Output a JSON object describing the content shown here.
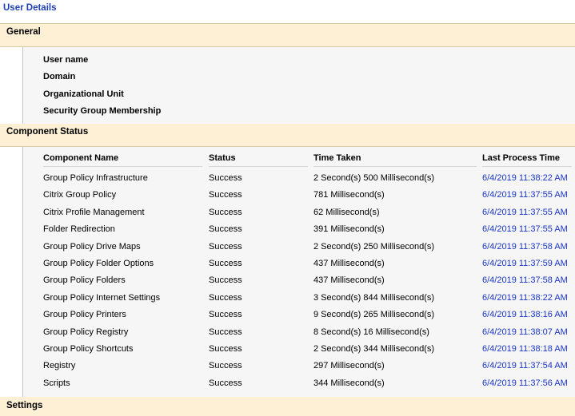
{
  "page": {
    "title": "User Details"
  },
  "general": {
    "title": "General",
    "fields": [
      {
        "label": "User name"
      },
      {
        "label": "Domain"
      },
      {
        "label": "Organizational Unit"
      },
      {
        "label": "Security Group Membership"
      }
    ]
  },
  "component_status": {
    "title": "Component Status",
    "columns": [
      "Component Name",
      "Status",
      "Time Taken",
      "Last Process Time"
    ],
    "rows": [
      {
        "name": "Group Policy Infrastructure",
        "status": "Success",
        "time_taken": "2 Second(s) 500 Millisecond(s)",
        "last_process_time": "6/4/2019 11:38:22 AM"
      },
      {
        "name": "Citrix Group Policy",
        "status": "Success",
        "time_taken": "781 Millisecond(s)",
        "last_process_time": "6/4/2019 11:37:55 AM"
      },
      {
        "name": "Citrix Profile Management",
        "status": "Success",
        "time_taken": "62 Millisecond(s)",
        "last_process_time": "6/4/2019 11:37:55 AM"
      },
      {
        "name": "Folder Redirection",
        "status": "Success",
        "time_taken": "391 Millisecond(s)",
        "last_process_time": "6/4/2019 11:37:55 AM"
      },
      {
        "name": "Group Policy Drive Maps",
        "status": "Success",
        "time_taken": "2 Second(s) 250 Millisecond(s)",
        "last_process_time": "6/4/2019 11:37:58 AM"
      },
      {
        "name": "Group Policy Folder Options",
        "status": "Success",
        "time_taken": "437 Millisecond(s)",
        "last_process_time": "6/4/2019 11:37:59 AM"
      },
      {
        "name": "Group Policy Folders",
        "status": "Success",
        "time_taken": "437 Millisecond(s)",
        "last_process_time": "6/4/2019 11:37:58 AM"
      },
      {
        "name": "Group Policy Internet Settings",
        "status": "Success",
        "time_taken": "3 Second(s) 844 Millisecond(s)",
        "last_process_time": "6/4/2019 11:38:22 AM"
      },
      {
        "name": "Group Policy Printers",
        "status": "Success",
        "time_taken": "9 Second(s) 265 Millisecond(s)",
        "last_process_time": "6/4/2019 11:38:16 AM"
      },
      {
        "name": "Group Policy Registry",
        "status": "Success",
        "time_taken": "8 Second(s) 16 Millisecond(s)",
        "last_process_time": "6/4/2019 11:38:07 AM"
      },
      {
        "name": "Group Policy Shortcuts",
        "status": "Success",
        "time_taken": "2 Second(s) 344 Millisecond(s)",
        "last_process_time": "6/4/2019 11:38:18 AM"
      },
      {
        "name": "Registry",
        "status": "Success",
        "time_taken": "297 Millisecond(s)",
        "last_process_time": "6/4/2019 11:37:54 AM"
      },
      {
        "name": "Scripts",
        "status": "Success",
        "time_taken": "344 Millisecond(s)",
        "last_process_time": "6/4/2019 11:37:56 AM"
      }
    ]
  },
  "settings": {
    "title": "Settings"
  },
  "colors": {
    "title_blue": "#1f3fb5",
    "section_bg": "#fdf0d4",
    "timestamp_blue": "#1a35c8"
  }
}
